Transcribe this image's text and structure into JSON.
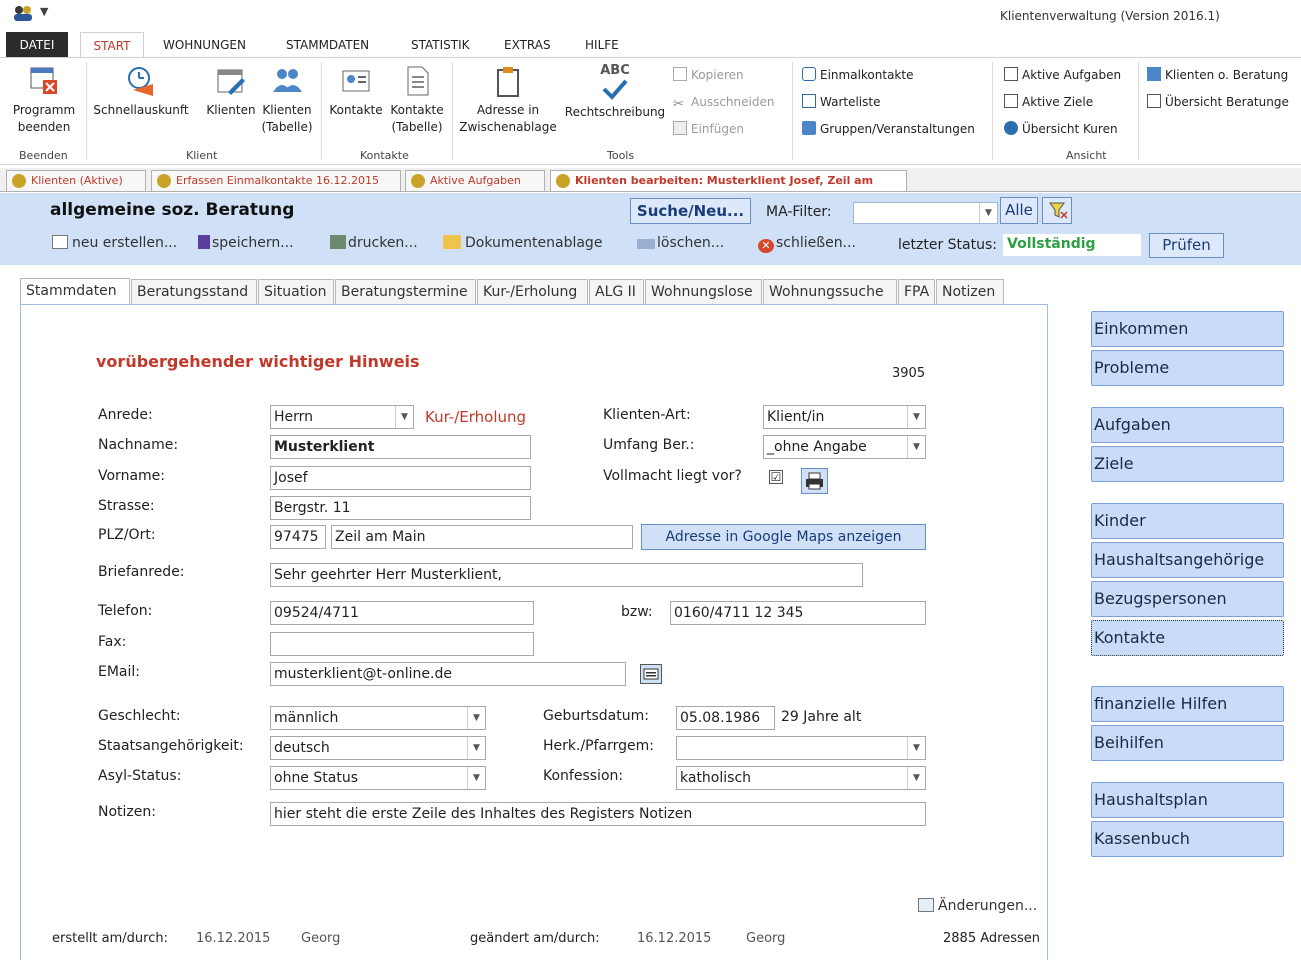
{
  "window": {
    "title": "Klientenverwaltung (Version 2016.1)"
  },
  "ribbon": {
    "tabs": [
      "DATEI",
      "START",
      "WOHNUNGEN",
      "STAMMDATEN",
      "STATISTIK",
      "EXTRAS",
      "HILFE"
    ],
    "groups": {
      "beenden": "Beenden",
      "klient": "Klient",
      "kontakte": "Kontakte",
      "tools": "Tools",
      "ansicht": "Ansicht"
    },
    "buttons": {
      "programm_beenden": [
        "Programm",
        "beenden"
      ],
      "schnellauskunft": "Schnellauskunft",
      "klienten": "Klienten",
      "klienten_tabelle": [
        "Klienten",
        "(Tabelle)"
      ],
      "kontakte": "Kontakte",
      "kontakte_tabelle": [
        "Kontakte",
        "(Tabelle)"
      ],
      "adresse_zwischenablage": [
        "Adresse in",
        "Zwischenablage"
      ],
      "rechtschreibung": "Rechtschreibung",
      "rechtschreibung_badge": "ABC",
      "kopieren": "Kopieren",
      "ausschneiden": "Ausschneiden",
      "einfuegen": "Einfügen",
      "einmalkontakte": "Einmalkontakte",
      "warteliste": "Warteliste",
      "gruppen": "Gruppen/Veranstaltungen",
      "aktive_aufgaben": "Aktive Aufgaben",
      "aktive_ziele": "Aktive Ziele",
      "uebersicht_kuren": "Übersicht Kuren",
      "klienten_o_beratung": "Klienten o. Beratung",
      "uebersicht_beratungen": "Übersicht Beratunge"
    }
  },
  "doc_tabs": [
    "Klienten (Aktive)",
    "Erfassen Einmalkontakte 16.12.2015",
    "Aktive Aufgaben",
    "Klienten bearbeiten: Musterklient Josef, Zeil am Main"
  ],
  "header": {
    "title": "allgemeine soz. Beratung",
    "suche": "Suche/Neu...",
    "ma_filter_label": "MA-Filter:",
    "ma_filter_value": "",
    "alle": "Alle",
    "toolbar": {
      "neu": "neu erstellen...",
      "speichern": "speichern...",
      "drucken": "drucken...",
      "dokumentenablage": "Dokumentenablage",
      "loeschen": "löschen...",
      "schliessen": "schließen..."
    },
    "status_label": "letzter Status:",
    "status_value": "Vollständig",
    "pruefen": "Prüfen"
  },
  "form_tabs": [
    "Stammdaten",
    "Beratungsstand",
    "Situation",
    "Beratungstermine",
    "Kur-/Erholung",
    "ALG II",
    "Wohnungslose",
    "Wohnungssuche",
    "FPA",
    "Notizen"
  ],
  "form": {
    "hinweis": "vorübergehender wichtiger Hinweis",
    "hinweis_num": "3905",
    "anrede_label": "Anrede:",
    "anrede": "Herrn",
    "kur_hint": "Kur-/Erholung",
    "nachname_label": "Nachname:",
    "nachname": "Musterklient",
    "vorname_label": "Vorname:",
    "vorname": "Josef",
    "strasse_label": "Strasse:",
    "strasse": "Bergstr. 11",
    "plzort_label": "PLZ/Ort:",
    "plz": "97475",
    "ort": "Zeil am Main",
    "gmaps": "Adresse in Google Maps anzeigen",
    "klientenart_label": "Klienten-Art:",
    "klientenart": "Klient/in",
    "umfang_label": "Umfang Ber.:",
    "umfang": "_ohne Angabe",
    "vollmacht_label": "Vollmacht liegt vor?",
    "vollmacht_check": "☑",
    "briefanrede_label": "Briefanrede:",
    "briefanrede": "Sehr geehrter Herr Musterklient,",
    "telefon_label": "Telefon:",
    "telefon": "09524/4711",
    "bzw_label": "bzw:",
    "telefon2": "0160/4711 12 345",
    "fax_label": "Fax:",
    "fax": "",
    "email_label": "EMail:",
    "email": "musterklient@t-online.de",
    "geschlecht_label": "Geschlecht:",
    "geschlecht": "männlich",
    "staat_label": "Staatsangehörigkeit:",
    "staat": "deutsch",
    "asyl_label": "Asyl-Status:",
    "asyl": "ohne Status",
    "geburt_label": "Geburtsdatum:",
    "geburt": "05.08.1986",
    "alter": "29 Jahre alt",
    "herk_label": "Herk./Pfarrgem:",
    "herk": "",
    "konfession_label": "Konfession:",
    "konfession": "katholisch",
    "notizen_label": "Notizen:",
    "notizen": "hier steht die erste Zeile des Inhaltes des Registers Notizen",
    "aenderungen": "Änderungen..."
  },
  "footer": {
    "erstellt_label": "erstellt am/durch:",
    "erstellt_datum": "16.12.2015",
    "erstellt_user": "Georg",
    "geaendert_label": "geändert am/durch:",
    "geaendert_datum": "16.12.2015",
    "geaendert_user": "Georg",
    "adressen": "2885 Adressen"
  },
  "side_buttons": [
    "Einkommen",
    "Probleme",
    "Aufgaben",
    "Ziele",
    "Kinder",
    "Haushaltsangehörige",
    "Bezugspersonen",
    "Kontakte",
    "finanzielle Hilfen",
    "Beihilfen",
    "Haushaltsplan",
    "Kassenbuch"
  ],
  "colors": {
    "accent_red": "#c0392b",
    "header_blue": "#cfe0f7",
    "status_green": "#2ea043"
  }
}
